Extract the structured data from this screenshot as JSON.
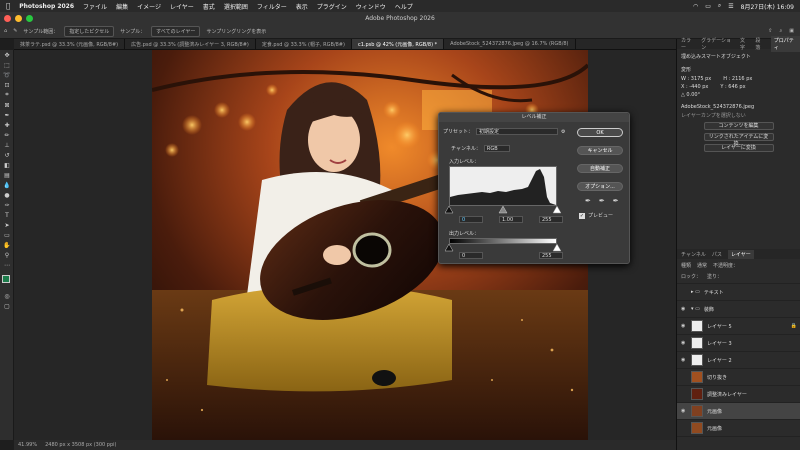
{
  "menubar": {
    "app": "Photoshop 2026",
    "items": [
      "ファイル",
      "編集",
      "イメージ",
      "レイヤー",
      "書式",
      "選択範囲",
      "フィルター",
      "表示",
      "プラグイン",
      "ウィンドウ",
      "ヘルプ"
    ],
    "clock": "8月27日(木) 16:09"
  },
  "window": {
    "title": "Adobe Photoshop 2026"
  },
  "options": {
    "sample_label": "サンプル範囲：",
    "sample_value": "指定したピクセル",
    "sample2": "サンプル：",
    "sample2_value": "すべてのレイヤー",
    "ring": "サンプリングリングを表示"
  },
  "tabs": [
    {
      "label": "抹茶ラテ.psd @ 33.3% (元画像, RGB/8#)"
    },
    {
      "label": "広告.psd @ 33.3% (調整済みレイヤー 3, RGB/8#)"
    },
    {
      "label": "定食.psd @ 33.3% (帽子, RGB/8#)"
    },
    {
      "label": "c1.psb @ 42% (元画像, RGB/8) *"
    },
    {
      "label": "AdobeStock_524372876.jpeg @ 16.7% (RGB/8)"
    }
  ],
  "status": {
    "zoom": "41.99%",
    "size": "2480 px x 3508 px (300 ppi)"
  },
  "panel": {
    "tabs": [
      "カラー",
      "グラデーション",
      "文字",
      "段落",
      "プロパティ"
    ],
    "active_tab": "プロパティ",
    "object_type": "埋め込みスマートオブジェクト",
    "section": "変形",
    "w": "W : 3175 px",
    "h": "H : 2116 px",
    "x": "X : -440 px",
    "y": "Y : 646 px",
    "angle": "△ 0.00°",
    "file": "AdobeStock_524372876.jpeg",
    "comp": "レイヤーカンプを選択しない",
    "btn1": "コンテンツを編集",
    "btn2": "リンクされたアイテムに変換...",
    "btn3": "レイヤーに変換"
  },
  "layers_panel": {
    "tabs": [
      "チャンネル",
      "パス",
      "レイヤー"
    ],
    "active_tab": "レイヤー",
    "search": "種類",
    "mode": "通常",
    "opacity": "不透明度：",
    "lock": "ロック：",
    "fill": "塗り：",
    "layers": [
      {
        "name": "テキスト"
      },
      {
        "name": "装飾"
      },
      {
        "name": "レイヤー 5"
      },
      {
        "name": "レイヤー 3"
      },
      {
        "name": "レイヤー 2"
      },
      {
        "name": "切り抜き"
      },
      {
        "name": "調整済みレイヤー"
      },
      {
        "name": "元画像"
      },
      {
        "name": "元画像"
      }
    ]
  },
  "dialog": {
    "title": "レベル補正",
    "preset_label": "プリセット：",
    "preset_value": "初期設定",
    "channel_label": "チャンネル：",
    "channel_value": "RGB",
    "input_label": "入力レベル：",
    "in_black": "0",
    "in_mid": "1.00",
    "in_white": "255",
    "output_label": "出力レベル：",
    "out_black": "0",
    "out_white": "255",
    "ok": "OK",
    "cancel": "キャンセル",
    "auto": "自動補正",
    "options": "オプション...",
    "preview": "プレビュー"
  }
}
